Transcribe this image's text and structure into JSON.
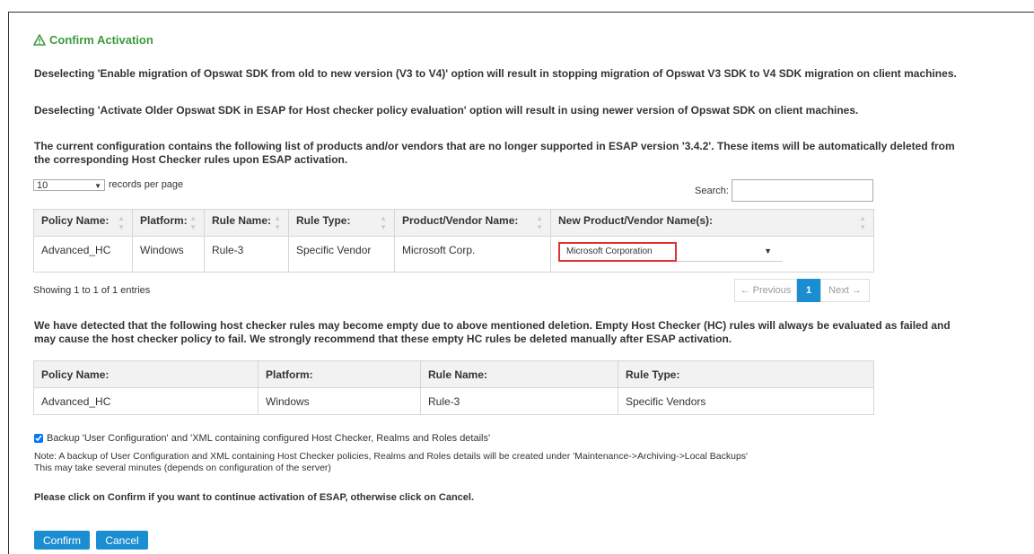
{
  "header": {
    "title": "Confirm Activation",
    "accent_color": "#3c9a3c",
    "title_icon": "warning-triangle-icon"
  },
  "messages": {
    "migration": "Deselecting 'Enable migration of Opswat SDK from old to new version (V3 to V4)' option will result in stopping migration of Opswat V3 SDK to V4 SDK migration on client machines.",
    "older_sdk": "Deselecting 'Activate Older Opswat SDK in ESAP for Host checker policy evaluation' option will result in using newer version of Opswat SDK on client machines.",
    "unsupported_line1": "The current configuration contains the following list of products and/or vendors that are no longer supported in ESAP version '3.4.2'. These items will be automatically deleted from",
    "unsupported_line2": "the corresponding Host Checker rules upon ESAP activation."
  },
  "table_controls": {
    "records_value": "10",
    "records_label": "records per page",
    "search_label": "Search:",
    "search_value": ""
  },
  "products_table": {
    "headers": [
      "Policy Name:",
      "Platform:",
      "Rule Name:",
      "Rule Type:",
      "Product/Vendor Name:",
      "New Product/Vendor Name(s):"
    ],
    "rows": [
      {
        "policy": "Advanced_HC",
        "platform": "Windows",
        "rule": "Rule-3",
        "type": "Specific Vendor",
        "vendor": "Microsoft Corp.",
        "new_vendor": "Microsoft Corporation"
      }
    ],
    "showing": "Showing 1 to 1 of 1 entries",
    "pager": {
      "previous": "← Previous",
      "page": "1",
      "next": "Next →"
    }
  },
  "empty_rules_notice": {
    "line1": "We have detected that the following host checker rules may become empty due to above mentioned deletion. Empty Host Checker (HC) rules will always be evaluated as failed and",
    "line2": "may cause the host checker policy to fail. We strongly recommend that these empty HC rules be deleted manually after ESAP activation."
  },
  "empty_rules_table": {
    "headers": [
      "Policy Name:",
      "Platform:",
      "Rule Name:",
      "Rule Type:"
    ],
    "rows": [
      {
        "policy": "Advanced_HC",
        "platform": "Windows",
        "rule": "Rule-3",
        "type": "Specific Vendors"
      }
    ]
  },
  "backup": {
    "checked": true,
    "label": "Backup 'User Configuration' and 'XML containing configured Host Checker, Realms and Roles details'",
    "note1": "Note: A backup of User Configuration and XML containing Host Checker policies, Realms and Roles details will be created under 'Maintenance->Archiving->Local Backups'",
    "note2": "This may take several minutes (depends on configuration of the server)"
  },
  "confirm_prompt": "Please click on Confirm if you want to continue activation of ESAP, otherwise click on Cancel.",
  "buttons": {
    "confirm": "Confirm",
    "cancel": "Cancel",
    "color": "#1b8ed1"
  },
  "highlight_color": "#e03030"
}
